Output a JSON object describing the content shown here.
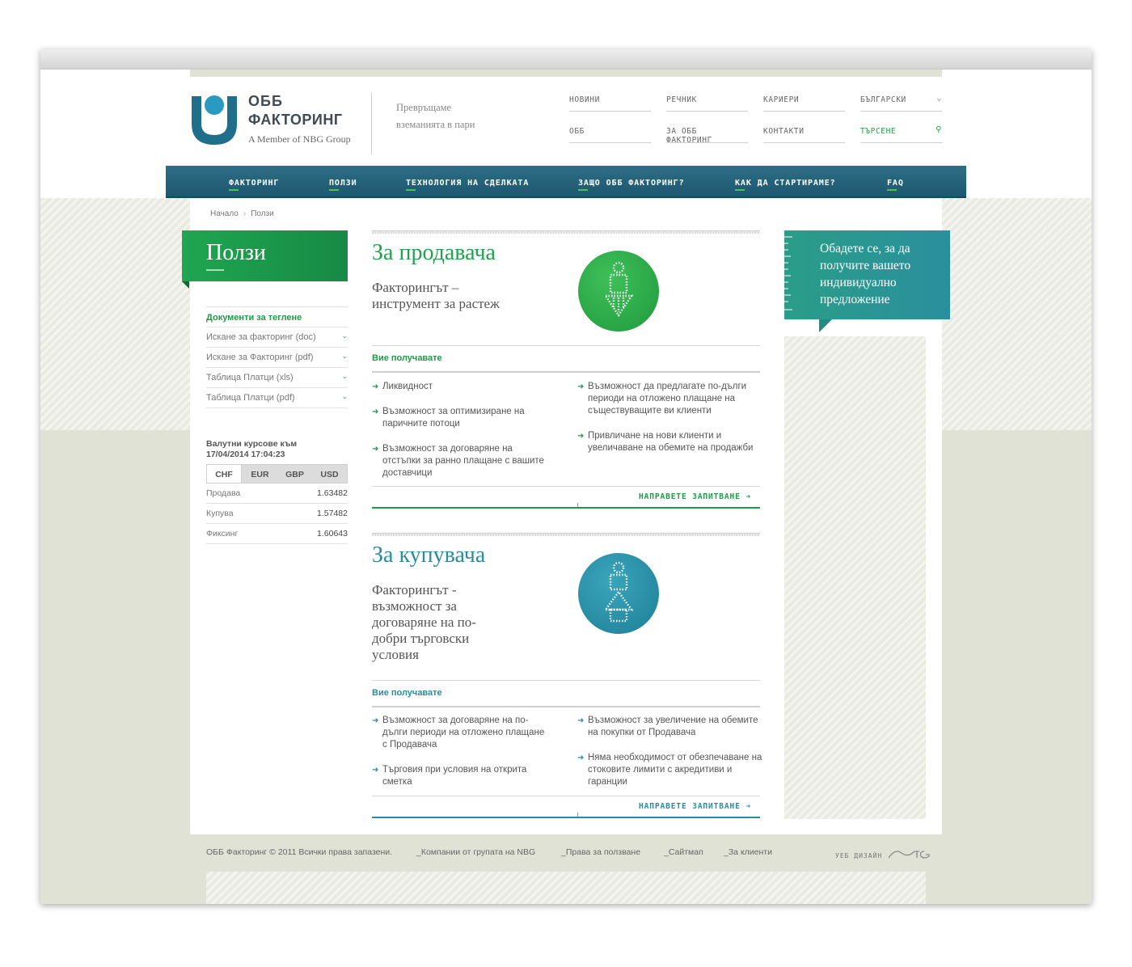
{
  "brand": {
    "name_line1": "ОББ",
    "name_line2": "ФАКТОРИНГ",
    "member": "A Member of NBG Group",
    "tagline": "Превръщаме вземанията в пари"
  },
  "top_links": {
    "news": "НОВИНИ",
    "glossary": "РЕЧНИК",
    "careers": "КАРИЕРИ",
    "language": "БЪЛГАРСКИ",
    "ubb": "ОББ",
    "about": "ЗА ОББ ФАКТОРИНГ",
    "contacts": "КОНТАКТИ",
    "search": "ТЪРСЕНЕ"
  },
  "nav": {
    "factoring": "ФАКТОРИНГ",
    "benefits": "ПОЛЗИ",
    "technology": "ТЕХНОЛОГИЯ НА СДЕЛКАТА",
    "why": "ЗАЩО ОББ ФАКТОРИНГ?",
    "start": "КАК ДА СТАРТИРАМЕ?",
    "faq": "FAQ"
  },
  "breadcrumb": {
    "home": "Начало",
    "sep": "›",
    "current": "Ползи"
  },
  "sidebar": {
    "title": "Ползи",
    "docs_heading": "Документи за теглене",
    "docs": [
      "Искане за факторинг (doc)",
      "Искане за Факторинг (pdf)",
      "Таблица Платци (xls)",
      "Таблица Платци (pdf)"
    ],
    "fx_heading_line1": "Валутни курсове към",
    "fx_heading_line2": "17/04/2014 17:04:23",
    "fx_tabs": [
      "CHF",
      "EUR",
      "GBP",
      "USD"
    ],
    "fx_rows": [
      {
        "label": "Продава",
        "value": "1.63482"
      },
      {
        "label": "Купува",
        "value": "1.57482"
      },
      {
        "label": "Фиксинг",
        "value": "1.60643"
      }
    ]
  },
  "seller": {
    "title": "За продавача",
    "subtitle": "Факторингът – инструмент за растеж",
    "receive": "Вие получавате",
    "left_bullets": [
      "Ликвидност",
      "Възможност за оптимизиране на паричните потоци",
      "Възможност за договаряне на отстъпки за ранно плащане с вашите доставчици"
    ],
    "right_bullets": [
      "Възможност да предлагате по-дълги периоди на отложено плащане на съществуващите ви клиенти",
      "Привличане на нови клиенти и увеличаване на обемите на продажби"
    ],
    "cta": "НАПРАВЕТЕ ЗАПИТВАНЕ"
  },
  "buyer": {
    "title": "За купувача",
    "subtitle": "Факторингът - възможност за договаряне на по-добри търговски условия",
    "receive": "Вие получавате",
    "left_bullets": [
      "Възможност за договаряне на по-дълги периоди на отложено плащане с Продавача",
      "Търговия при условия на открита сметка"
    ],
    "right_bullets": [
      "Възможност за увеличение на обемите на покупки от Продавача",
      "Няма необходимост от обезпечаване на стоковите лимити с акредитиви и гаранции"
    ],
    "cta": "НАПРАВЕТЕ ЗАПИТВАНЕ"
  },
  "callout": {
    "text": "Обадете се, за да получите вашето индивидуално предложение"
  },
  "footer": {
    "copyright": "ОББ Факторинг © 2011 Всички права запазени.",
    "links": [
      "Компании от групата на NBG",
      "Права за ползване",
      "Сайтмап",
      "За клиенти"
    ],
    "web_design": "УЕБ ДИЗАЙН"
  },
  "colors": {
    "green": "#1fa650",
    "teal": "#2a8f9d",
    "nav": "#1d5870"
  },
  "icons": [
    "logo-icon",
    "chevron-down-icon",
    "search-icon",
    "arrow-right-icon",
    "seller-arrow-down-icon",
    "buyer-arrow-up-icon"
  ]
}
